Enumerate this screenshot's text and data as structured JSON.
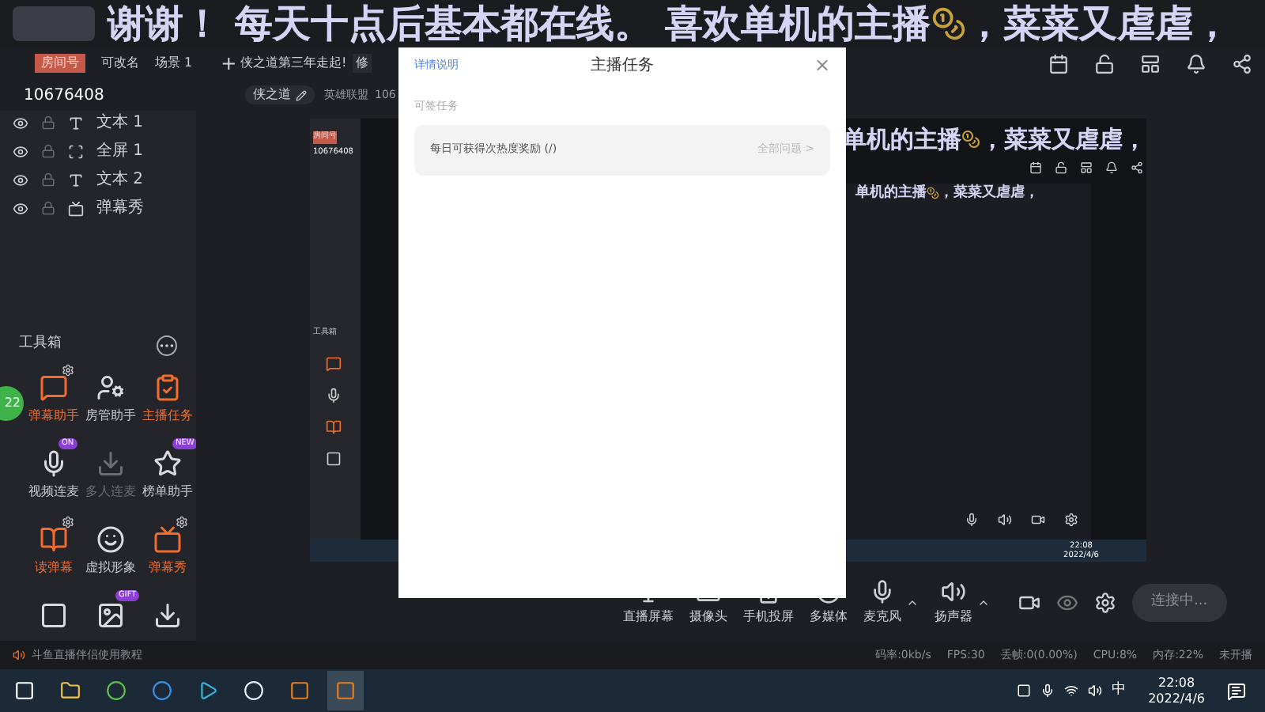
{
  "overlay": {
    "before": "谢谢！ 每天十点后基本都在线。 喜欢单机的主播",
    "after": "，菜菜又虐虐，"
  },
  "header": {
    "room_badge": "房间号",
    "room_id": "10676408",
    "rename": "可改名",
    "scene": "场景 1",
    "add": "+",
    "stream_title": "侠之道第三年走起!",
    "edit": "修",
    "tag": "侠之道",
    "category": "英雄联盟",
    "id_partial": "106"
  },
  "sources": [
    {
      "name": "文本 1",
      "kind": "text"
    },
    {
      "name": "全屏 1",
      "kind": "screen"
    },
    {
      "name": "文本 2",
      "kind": "text"
    },
    {
      "name": "弹幕秀",
      "kind": "danmaku"
    }
  ],
  "toolbox": {
    "title": "工具箱",
    "items": [
      {
        "label": "弹幕助手",
        "highlight": true,
        "settings": true
      },
      {
        "label": "房管助手",
        "highlight": false,
        "settings": false
      },
      {
        "label": "主播任务",
        "highlight": true,
        "settings": false
      },
      {
        "label": "视频连麦",
        "highlight": false,
        "settings": false,
        "badge": "ON"
      },
      {
        "label": "多人连麦",
        "highlight": false,
        "settings": false,
        "disabled": true
      },
      {
        "label": "榜单助手",
        "highlight": false,
        "settings": false,
        "badge": "NEW"
      },
      {
        "label": "读弹幕",
        "highlight": true,
        "settings": true
      },
      {
        "label": "虚拟形象",
        "highlight": false,
        "settings": false
      },
      {
        "label": "弹幕秀",
        "highlight": true,
        "settings": true
      },
      {
        "highlight": false,
        "settings": false
      },
      {
        "highlight": false,
        "settings": false,
        "badge": "GIFT"
      },
      {
        "highlight": false,
        "settings": false
      }
    ]
  },
  "float_badge": "22",
  "preview": {
    "room_badge": "房间号",
    "room_id": "10676408",
    "toolbox": "工具箱",
    "overlay": "单机的主播",
    "overlay_after": "，菜菜又虐虐，",
    "overlay_inner": "单机的主播",
    "overlay_inner_after": "，菜菜又虐虐，",
    "clock_time": "22:08",
    "clock_date": "2022/4/6"
  },
  "modal": {
    "link": "详情说明",
    "title": "主播任务",
    "close": "×",
    "section": "可签任务",
    "task": "每日可获得次热度奖励 (/)",
    "more": "全部问题 >"
  },
  "controls": [
    {
      "label": "直播屏幕",
      "menu": false
    },
    {
      "label": "摄像头",
      "menu": false
    },
    {
      "label": "手机投屏",
      "menu": false
    },
    {
      "label": "多媒体",
      "menu": false
    },
    {
      "label": "麦克风",
      "menu": true
    },
    {
      "label": "扬声器",
      "menu": true
    }
  ],
  "connect_button": "连接中...",
  "tutorial": "斗鱼直播伴侣使用教程",
  "status": [
    "码率:0kb/s",
    "FPS:30",
    "丢帧:0(0.00%)",
    "CPU:8%",
    "内存:22%",
    "未开播"
  ],
  "taskbar": {
    "apps": [
      {
        "selected": false
      },
      {
        "selected": false
      },
      {
        "selected": false
      },
      {
        "selected": false
      },
      {
        "selected": false
      },
      {
        "selected": false
      },
      {
        "selected": false
      },
      {
        "selected": true
      }
    ],
    "ime": "中",
    "time": "22:08",
    "date": "2022/4/6"
  }
}
